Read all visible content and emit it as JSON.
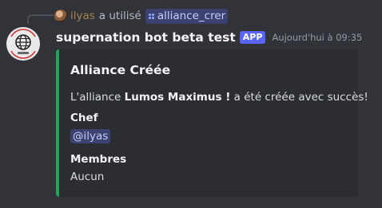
{
  "reply": {
    "username": "ilyas",
    "verb": "a utilisé",
    "command": "alliance_crer"
  },
  "message": {
    "bot_name": "supernation bot beta test",
    "app_tag": "APP",
    "timestamp": "Aujourd'hui à 09:35"
  },
  "embed": {
    "accent_color": "#23a559",
    "title": "Alliance Créée",
    "description_prefix": "L'alliance",
    "alliance_name": "Lumos Maximus !",
    "description_suffix": "a été créée avec succès!",
    "fields": [
      {
        "name": "Chef",
        "value": "@ilyas"
      },
      {
        "name": "Membres",
        "value": "Aucun"
      }
    ]
  },
  "icons": {
    "avatar": "globe-icon",
    "command": "slash-command-icon"
  }
}
